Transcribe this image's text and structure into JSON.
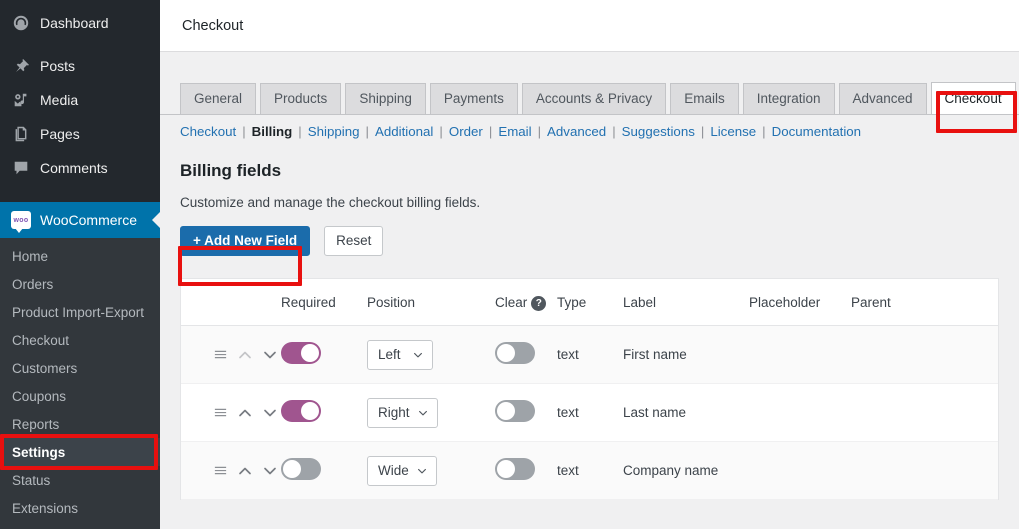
{
  "sidebar": {
    "top_items": [
      {
        "label": "Dashboard",
        "icon": "dashboard-icon"
      },
      {
        "label": "Posts",
        "icon": "pin-icon"
      },
      {
        "label": "Media",
        "icon": "media-icon"
      },
      {
        "label": "Pages",
        "icon": "pages-icon"
      },
      {
        "label": "Comments",
        "icon": "comments-icon"
      }
    ],
    "woocommerce": {
      "label": "WooCommerce",
      "badge": "woo",
      "icon": "woocommerce-icon"
    },
    "submenu": [
      {
        "label": "Home",
        "current": false
      },
      {
        "label": "Orders",
        "current": false
      },
      {
        "label": "Product Import-Export",
        "current": false
      },
      {
        "label": "Checkout",
        "current": false
      },
      {
        "label": "Customers",
        "current": false
      },
      {
        "label": "Coupons",
        "current": false
      },
      {
        "label": "Reports",
        "current": false
      },
      {
        "label": "Settings",
        "current": true
      },
      {
        "label": "Status",
        "current": false
      },
      {
        "label": "Extensions",
        "current": false
      }
    ]
  },
  "header": {
    "title": "Checkout"
  },
  "tabs": [
    {
      "label": "General",
      "active": false
    },
    {
      "label": "Products",
      "active": false
    },
    {
      "label": "Shipping",
      "active": false
    },
    {
      "label": "Payments",
      "active": false
    },
    {
      "label": "Accounts & Privacy",
      "active": false
    },
    {
      "label": "Emails",
      "active": false
    },
    {
      "label": "Integration",
      "active": false
    },
    {
      "label": "Advanced",
      "active": false
    },
    {
      "label": "Checkout",
      "active": true
    }
  ],
  "subnav": [
    {
      "label": "Checkout",
      "current": false
    },
    {
      "label": "Billing",
      "current": true
    },
    {
      "label": "Shipping",
      "current": false
    },
    {
      "label": "Additional",
      "current": false
    },
    {
      "label": "Order",
      "current": false
    },
    {
      "label": "Email",
      "current": false
    },
    {
      "label": "Advanced",
      "current": false
    },
    {
      "label": "Suggestions",
      "current": false
    },
    {
      "label": "License",
      "current": false
    },
    {
      "label": "Documentation",
      "current": false
    }
  ],
  "section": {
    "title": "Billing fields",
    "description": "Customize and manage the checkout billing fields.",
    "add_button": "+ Add New Field",
    "reset_button": "Reset"
  },
  "table": {
    "headers": {
      "handle": "",
      "required": "Required",
      "position": "Position",
      "clear": "Clear",
      "clear_help": "?",
      "type": "Type",
      "label": "Label",
      "placeholder": "Placeholder",
      "parent": "Parent"
    },
    "rows": [
      {
        "required": "on",
        "position": "Left",
        "clear": "off",
        "type": "text",
        "label": "First name",
        "placeholder": "",
        "parent": ""
      },
      {
        "required": "on",
        "position": "Right",
        "clear": "off",
        "type": "text",
        "label": "Last name",
        "placeholder": "",
        "parent": ""
      },
      {
        "required": "off",
        "position": "Wide",
        "clear": "off",
        "type": "text",
        "label": "Company name",
        "placeholder": "",
        "parent": ""
      }
    ]
  },
  "annotations": {
    "color": "#e8100f",
    "targets": [
      "checkout-tab",
      "add-new-field-button",
      "settings-menu-item"
    ]
  },
  "colors": {
    "admin_bg": "#23282d",
    "submenu_bg": "#32373c",
    "woo_blue": "#0073aa",
    "primary_button": "#1b6cab",
    "link": "#2271b1",
    "toggle_on": "#a0558f",
    "toggle_off": "#9ea3a8"
  }
}
